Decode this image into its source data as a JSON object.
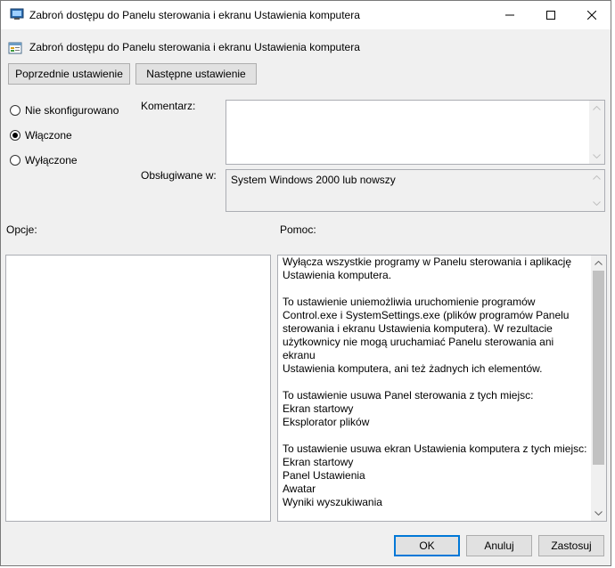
{
  "window": {
    "title": "Zabroń dostępu do Panelu sterowania i ekranu Ustawienia komputera",
    "header_title": "Zabroń dostępu do Panelu sterowania i ekranu Ustawienia komputera"
  },
  "nav": {
    "prev_label": "Poprzednie ustawienie",
    "next_label": "Następne ustawienie"
  },
  "state": {
    "options": [
      {
        "label": "Nie skonfigurowano",
        "selected": false
      },
      {
        "label": "Włączone",
        "selected": true
      },
      {
        "label": "Wyłączone",
        "selected": false
      }
    ]
  },
  "comment": {
    "label": "Komentarz:",
    "value": ""
  },
  "supported": {
    "label": "Obsługiwane w:",
    "value": "System Windows 2000 lub nowszy"
  },
  "options_panel": {
    "label": "Opcje:"
  },
  "help": {
    "label": "Pomoc:",
    "paragraphs": [
      [
        "Wyłącza wszystkie programy w Panelu sterowania i aplikację",
        "Ustawienia komputera."
      ],
      [
        "To ustawienie uniemożliwia uruchomienie programów",
        "Control.exe i SystemSettings.exe (plików programów Panelu",
        "sterowania i ekranu Ustawienia komputera). W rezultacie",
        "użytkownicy nie mogą uruchamiać Panelu sterowania ani ekranu",
        "Ustawienia komputera, ani też żadnych ich elementów."
      ],
      [
        "To ustawienie usuwa Panel sterowania z tych miejsc:",
        "Ekran startowy",
        "Eksplorator plików"
      ],
      [
        "To ustawienie usuwa ekran Ustawienia komputera z tych miejsc:",
        "Ekran startowy",
        "Panel Ustawienia",
        "Awatar",
        "Wyniki wyszukiwania"
      ]
    ]
  },
  "footer": {
    "ok_label": "OK",
    "cancel_label": "Anuluj",
    "apply_label": "Zastosuj"
  },
  "colors": {
    "accent": "#0078d7",
    "dialog_bg": "#f0f0f0",
    "field_border": "#abadb3"
  }
}
